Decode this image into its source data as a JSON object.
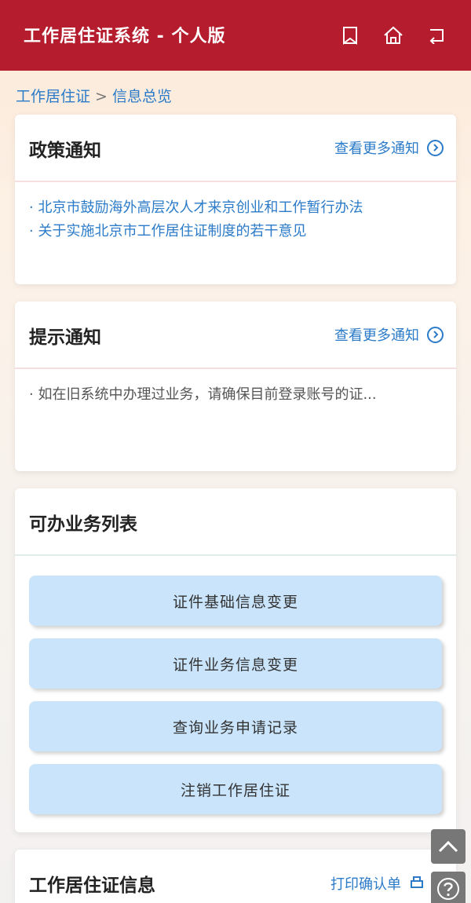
{
  "header": {
    "title": "工作居住证系统 - 个人版",
    "icons": [
      "bookmark-icon",
      "home-icon",
      "back-icon"
    ]
  },
  "breadcrumb": {
    "root": "工作居住证",
    "separator": ">",
    "current": "信息总览"
  },
  "policy_card": {
    "title": "政策通知",
    "more": "查看更多通知",
    "items": [
      "· 北京市鼓励海外高层次人才来京创业和工作暂行办法",
      "· 关于实施北京市工作居住证制度的若干意见"
    ]
  },
  "tip_card": {
    "title": "提示通知",
    "more": "查看更多通知",
    "items": [
      "· 如在旧系统中办理过业务，请确保目前登录账号的证..."
    ]
  },
  "business_card": {
    "title": "可办业务列表",
    "buttons": [
      "证件基础信息变更",
      "证件业务信息变更",
      "查询业务申请记录",
      "注销工作居住证"
    ]
  },
  "cert_card": {
    "title": "工作居住证信息",
    "print": "打印确认单"
  },
  "colors": {
    "header": "#b51c2d",
    "link": "#2b7bc8",
    "button_bg": "#c9e4fb"
  }
}
